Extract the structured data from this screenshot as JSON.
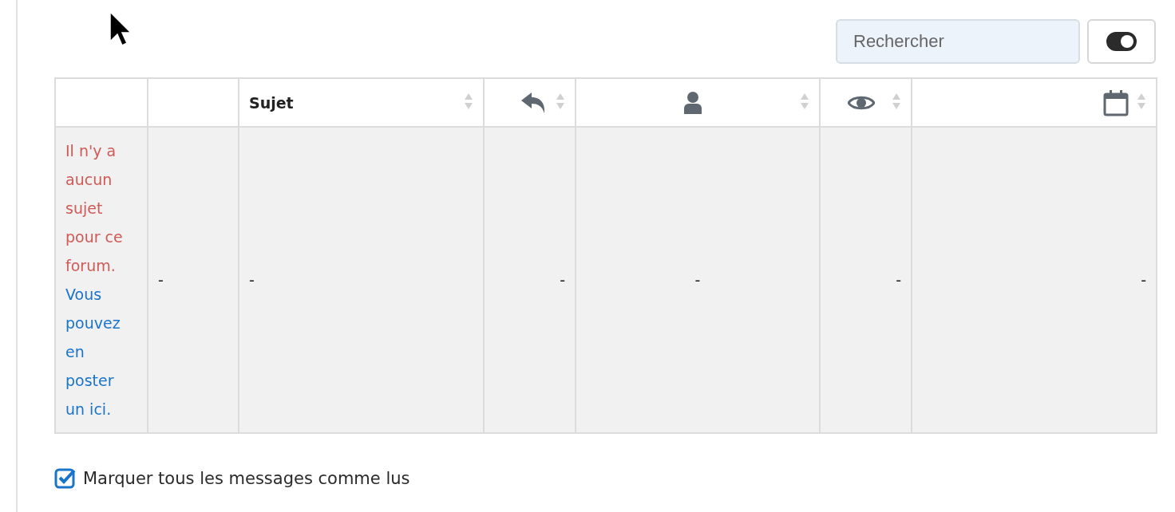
{
  "search": {
    "placeholder": "Rechercher"
  },
  "display_toggle": {
    "on": true
  },
  "table": {
    "columns": [
      {
        "kind": "blank",
        "sortable": false
      },
      {
        "kind": "blank",
        "sortable": false
      },
      {
        "kind": "text",
        "label": "Sujet",
        "sortable": true
      },
      {
        "kind": "icon",
        "sortable": true
      },
      {
        "kind": "icon",
        "sortable": true
      },
      {
        "kind": "icon",
        "sortable": true
      },
      {
        "kind": "icon",
        "sortable": true
      }
    ],
    "rows": [
      {
        "cells": [
          {
            "text": "Il n'y a aucun sujet pour ce forum.",
            "link": "Vous pouvez en poster un ici."
          },
          {
            "text": "-"
          },
          {
            "text": "-"
          },
          {
            "text": "-"
          },
          {
            "text": "-"
          },
          {
            "text": "-"
          },
          {
            "text": "-"
          }
        ]
      }
    ]
  },
  "mark_all_read": {
    "label": "Marquer tous les messages comme lus",
    "checked": true
  }
}
